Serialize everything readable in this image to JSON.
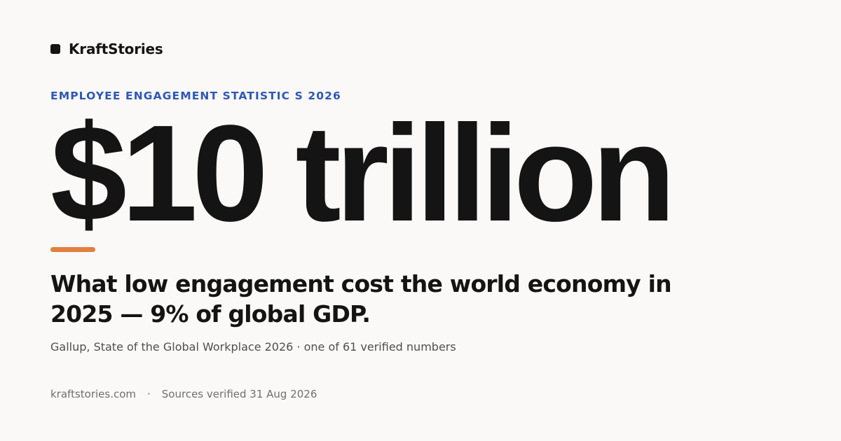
{
  "brand": {
    "name": "KraftStories",
    "logo_icon": "square-logo-icon"
  },
  "eyebrow": "EMPLOYEE ENGAGEMENT STATISTIC S 2026",
  "hero_value": "$10 trillion",
  "accent_color": "#e07f3f",
  "eyebrow_color": "#2f57b5",
  "headline": "What low engagement cost the world economy in 2025 — 9% of global GDP.",
  "source": "Gallup, State of the Global Workplace 2026 · one of 61 verified numbers",
  "footer": {
    "domain": "kraftstories.com",
    "separator": "·",
    "verified": "Sources verified 31 Aug 2026"
  }
}
